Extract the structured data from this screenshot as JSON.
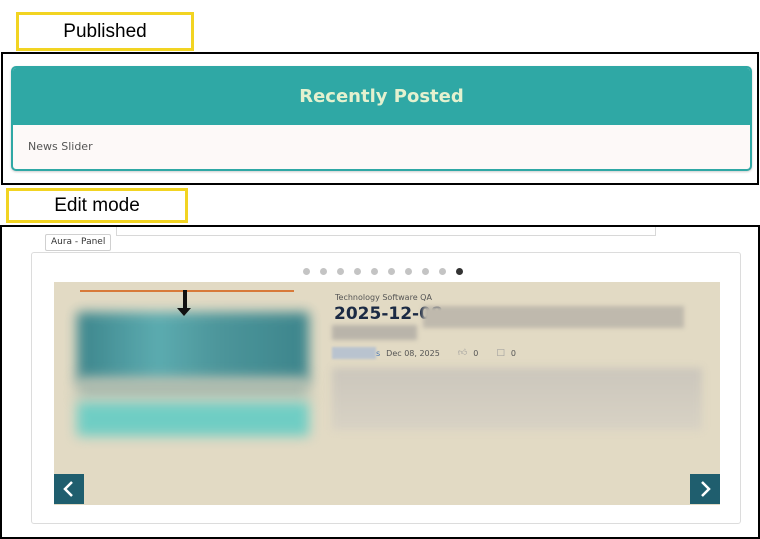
{
  "published": {
    "label": "Published",
    "header_title": "Recently Posted",
    "body_text": "News Slider"
  },
  "edit_mode": {
    "label": "Edit mode",
    "panel_tag": "Aura - Panel",
    "carousel": {
      "dot_count": 10,
      "active_dot": 10,
      "slide": {
        "category": "Technology Software QA",
        "title_visible": "2025-12-08",
        "author_suffix": "s",
        "date": "Dec 08, 2025",
        "likes": "0",
        "comments": "0"
      }
    }
  },
  "icons": {
    "like": "thumbs-up-icon",
    "comment": "comment-icon",
    "prev": "chevron-left-icon",
    "next": "chevron-right-icon"
  },
  "colors": {
    "accent_yellow": "#f2d422",
    "teal_header": "#2fa8a5",
    "slide_bg": "#e2dac4",
    "nav_button": "#1f5e6e"
  }
}
